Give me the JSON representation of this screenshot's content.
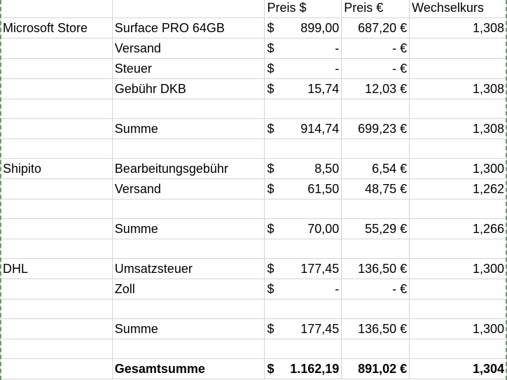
{
  "header": {
    "preis_usd": "Preis $",
    "preis_eur": "Preis €",
    "kurs": "Wechselkurs"
  },
  "rows": [
    {
      "group": "Microsoft Store",
      "item": "Surface PRO 64GB",
      "usd_sym": "$",
      "usd": "899,00",
      "eur": "687,20 €",
      "kurs": "1,308"
    },
    {
      "group": "",
      "item": "Versand",
      "usd_sym": "$",
      "usd": "-",
      "eur": "-   €",
      "kurs": ""
    },
    {
      "group": "",
      "item": "Steuer",
      "usd_sym": "$",
      "usd": "-",
      "eur": "-   €",
      "kurs": ""
    },
    {
      "group": "",
      "item": "Gebühr DKB",
      "usd_sym": "$",
      "usd": "15,74",
      "eur": "12,03 €",
      "kurs": "1,308"
    },
    {
      "group": "",
      "item": "",
      "usd_sym": "",
      "usd": "",
      "eur": "",
      "kurs": ""
    },
    {
      "group": "",
      "item": "Summe",
      "usd_sym": "$",
      "usd": "914,74",
      "eur": "699,23 €",
      "kurs": "1,308"
    },
    {
      "group": "",
      "item": "",
      "usd_sym": "",
      "usd": "",
      "eur": "",
      "kurs": ""
    },
    {
      "group": "Shipito",
      "item": "Bearbeitungsgebühr",
      "usd_sym": "$",
      "usd": "8,50",
      "eur": "6,54 €",
      "kurs": "1,300"
    },
    {
      "group": "",
      "item": "Versand",
      "usd_sym": "$",
      "usd": "61,50",
      "eur": "48,75 €",
      "kurs": "1,262"
    },
    {
      "group": "",
      "item": "",
      "usd_sym": "",
      "usd": "",
      "eur": "",
      "kurs": ""
    },
    {
      "group": "",
      "item": "Summe",
      "usd_sym": "$",
      "usd": "70,00",
      "eur": "55,29 €",
      "kurs": "1,266"
    },
    {
      "group": "",
      "item": "",
      "usd_sym": "",
      "usd": "",
      "eur": "",
      "kurs": ""
    },
    {
      "group": "DHL",
      "item": "Umsatzsteuer",
      "usd_sym": "$",
      "usd": "177,45",
      "eur": "136,50 €",
      "kurs": "1,300"
    },
    {
      "group": "",
      "item": "Zoll",
      "usd_sym": "$",
      "usd": "-",
      "eur": "-   €",
      "kurs": ""
    },
    {
      "group": "",
      "item": "",
      "usd_sym": "",
      "usd": "",
      "eur": "",
      "kurs": ""
    },
    {
      "group": "",
      "item": "Summe",
      "usd_sym": "$",
      "usd": "177,45",
      "eur": "136,50 €",
      "kurs": "1,300"
    },
    {
      "group": "",
      "item": "",
      "usd_sym": "",
      "usd": "",
      "eur": "",
      "kurs": ""
    }
  ],
  "total": {
    "label": "Gesamtsumme",
    "usd_sym": "$",
    "usd": "1.162,19",
    "eur": "891,02 €",
    "kurs": "1,304"
  }
}
